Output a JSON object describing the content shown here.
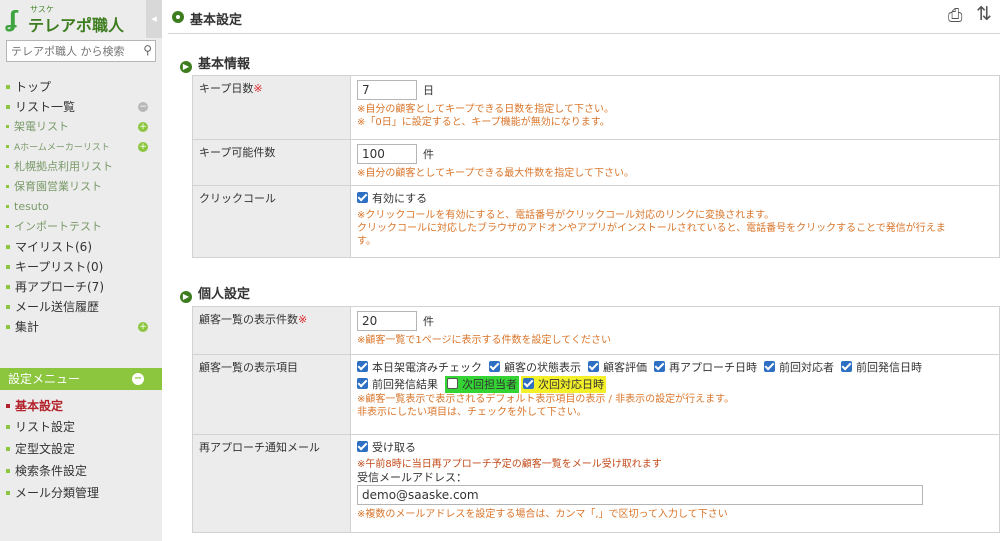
{
  "sidebar": {
    "logo": {
      "ruby": "サスケ",
      "name": "テレアポ職人"
    },
    "collapse": "◂",
    "search": {
      "placeholder": "テレアポ職人 から検索"
    },
    "items": [
      {
        "label": "トップ"
      },
      {
        "label": "リスト一覧"
      },
      {
        "label": "架電リスト"
      },
      {
        "label": "Aホームメーカーリスト"
      },
      {
        "label": "札幌拠点利用リスト"
      },
      {
        "label": "保育園営業リスト"
      },
      {
        "label": "tesuto"
      },
      {
        "label": "インポートテスト"
      },
      {
        "label": "マイリスト(6)"
      },
      {
        "label": "キープリスト(0)"
      },
      {
        "label": "再アプローチ(7)"
      },
      {
        "label": "メール送信履歴"
      },
      {
        "label": "集計"
      }
    ],
    "settings_menu": {
      "title": "設定メニュー",
      "items": [
        {
          "label": "基本設定"
        },
        {
          "label": "リスト設定"
        },
        {
          "label": "定型文設定"
        },
        {
          "label": "検索条件設定"
        },
        {
          "label": "メール分類管理"
        }
      ]
    }
  },
  "main": {
    "title": "基本設定",
    "basic_info": {
      "heading": "基本情報",
      "keep_days": {
        "label": "キープ日数",
        "required_mark": "※",
        "value": "7",
        "unit": "日",
        "note1": "※自分の顧客としてキープできる日数を指定して下さい。",
        "note2": "※「0日」に設定すると、キープ機能が無効になります。"
      },
      "keep_count": {
        "label": "キープ可能件数",
        "value": "100",
        "unit": "件",
        "note": "※自分の顧客としてキープできる最大件数を指定して下さい。"
      },
      "click_call": {
        "label": "クリックコール",
        "checkbox_label": "有効にする",
        "checked": true,
        "note1": "※クリックコールを有効にすると、電話番号がクリックコール対応のリンクに変換されます。",
        "note2": "クリックコールに対応したブラウザのアドオンやアプリがインストールされていると、電話番号をクリックすることで発信が行えま",
        "note3": "す。"
      }
    },
    "personal": {
      "heading": "個人設定",
      "list_count": {
        "label": "顧客一覧の表示件数",
        "required_mark": "※",
        "value": "20",
        "unit": "件",
        "note": "※顧客一覧で1ページに表示する件数を設定してください"
      },
      "display_items": {
        "label": "顧客一覧の表示項目",
        "options": [
          {
            "label": "本日架電済みチェック",
            "checked": true
          },
          {
            "label": "顧客の状態表示",
            "checked": true
          },
          {
            "label": "顧客評価",
            "checked": true
          },
          {
            "label": "再アプローチ日時",
            "checked": true
          },
          {
            "label": "前回対応者",
            "checked": true
          },
          {
            "label": "前回発信日時",
            "checked": true
          },
          {
            "label": "前回発信結果",
            "checked": true
          },
          {
            "label": "次回担当者",
            "checked": false
          },
          {
            "label": "次回対応日時",
            "checked": true
          }
        ],
        "note1": "※顧客一覧表示で表示されるデフォルト表示項目の表示 / 非表示の設定が行えます。",
        "note2": "非表示にしたい項目は、チェックを外して下さい。"
      },
      "reapproach_mail": {
        "label": "再アプローチ通知メール",
        "checkbox_label": "受け取る",
        "checked": true,
        "note": "※午前8時に当日再アプローチ予定の顧客一覧をメール受け取れます",
        "address_label": "受信メールアドレス：",
        "address_value": "demo@saaske.com",
        "address_note": "※複数のメールアドレスを設定する場合は、カンマ「,」で区切って入力して下さい"
      }
    }
  },
  "colors": {
    "brand_green": "#8cc63e",
    "dark_green": "#3e7d1f",
    "active_red": "#b3222a",
    "note_orange": "#d9752a",
    "checkbox_blue": "#2d6fc3"
  }
}
